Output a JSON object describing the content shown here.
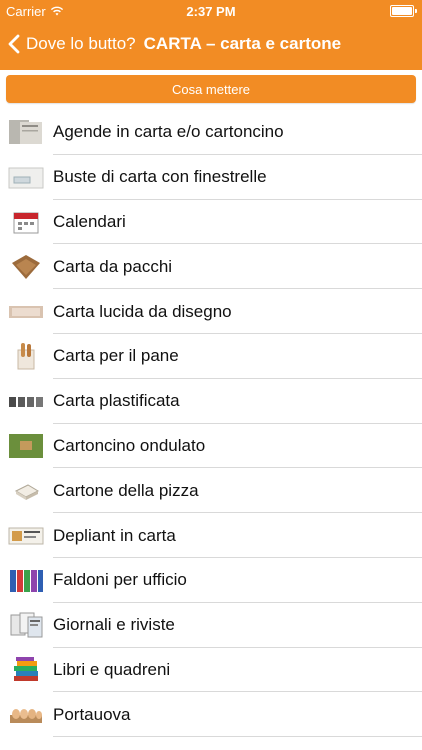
{
  "status_bar": {
    "carrier": "Carrier",
    "time": "2:37 PM"
  },
  "navbar": {
    "back_label": "Dove lo butto?",
    "title": "CARTA – carta e cartone"
  },
  "action_button": {
    "label": "Cosa mettere"
  },
  "colors": {
    "accent": "#f28c24"
  },
  "list": [
    {
      "label": "Agende in carta e/o cartoncino",
      "icon": "agenda-icon"
    },
    {
      "label": "Buste di carta con finestrelle",
      "icon": "envelope-icon"
    },
    {
      "label": "Calendari",
      "icon": "calendar-icon"
    },
    {
      "label": "Carta da pacchi",
      "icon": "wrapping-paper-icon"
    },
    {
      "label": "Carta lucida da disegno",
      "icon": "tracing-paper-icon"
    },
    {
      "label": "Carta per il pane",
      "icon": "bread-bag-icon"
    },
    {
      "label": "Carta plastificata",
      "icon": "laminated-paper-icon"
    },
    {
      "label": "Cartoncino ondulato",
      "icon": "corrugated-cardboard-icon"
    },
    {
      "label": "Cartone della pizza",
      "icon": "pizza-box-icon"
    },
    {
      "label": "Depliant in carta",
      "icon": "leaflet-icon"
    },
    {
      "label": "Faldoni per ufficio",
      "icon": "office-binders-icon"
    },
    {
      "label": "Giornali e riviste",
      "icon": "newspapers-icon"
    },
    {
      "label": "Libri e quadreni",
      "icon": "books-icon"
    },
    {
      "label": "Portauova",
      "icon": "egg-carton-icon"
    }
  ]
}
